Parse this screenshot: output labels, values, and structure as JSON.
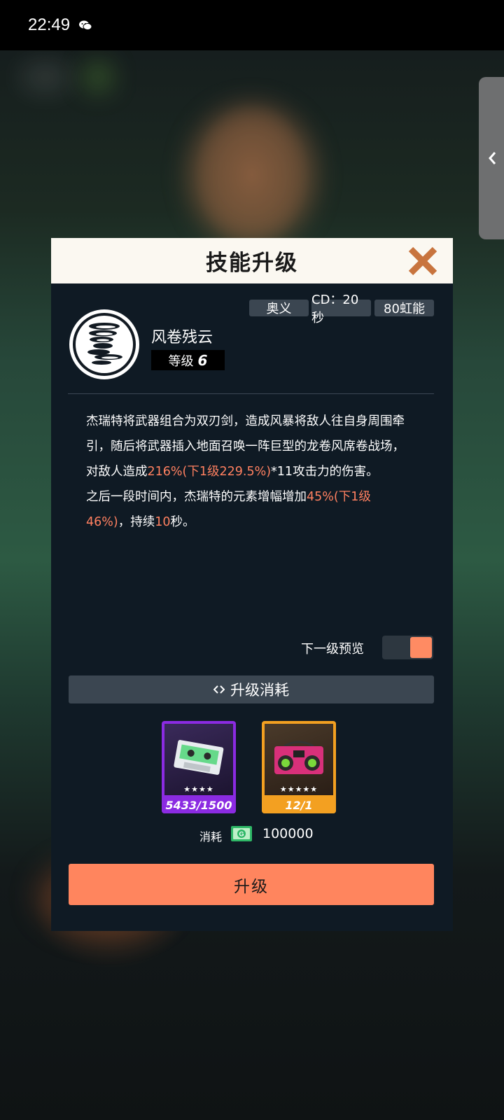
{
  "status_bar": {
    "time": "22:49",
    "app_icon": "wechat-icon"
  },
  "side_tab": {
    "icon": "chevron-left-icon"
  },
  "dialog": {
    "title": "技能升级",
    "close_icon": "close-icon",
    "tags": [
      "奥义",
      "CD：20秒",
      "80虹能"
    ],
    "skill": {
      "icon": "tornado-icon",
      "name": "风卷残云",
      "level_label": "等级",
      "level_value": "6"
    },
    "description": {
      "p1_a": "杰瑞特将武器组合为双刃剑，造成风暴将敌人往自身周围牵引，随后将武器插入地面召唤一阵巨型的龙卷风席卷战场，对敌人造成",
      "p1_hl": "216%(下1级229.5%)",
      "p1_b": "*11攻击力的伤害。",
      "p2_a": "之后一段时间内，杰瑞特的元素增幅增加",
      "p2_hl1": "45%(下1级46%)",
      "p2_b": "，持续",
      "p2_hl2": "10",
      "p2_c": "秒。"
    },
    "preview": {
      "label": "下一级预览",
      "enabled": true
    },
    "cost": {
      "title": "升级消耗",
      "title_icon": "diamond-arrows-icon",
      "items": [
        {
          "name": "cassette-tape-icon",
          "stars": "★★★★",
          "count": "5433/1500",
          "frame_color": "#8b2be2"
        },
        {
          "name": "boombox-icon",
          "stars": "★★★★★",
          "count": "12/1",
          "frame_color": "#f3a021"
        }
      ],
      "currency_label": "消耗",
      "currency_icon": "gold-cash-icon",
      "currency_value": "100000"
    },
    "upgrade_button": "升级",
    "colors": {
      "accent": "#ff855e",
      "highlight": "#ff8060",
      "panel": "#0f1a24"
    }
  }
}
